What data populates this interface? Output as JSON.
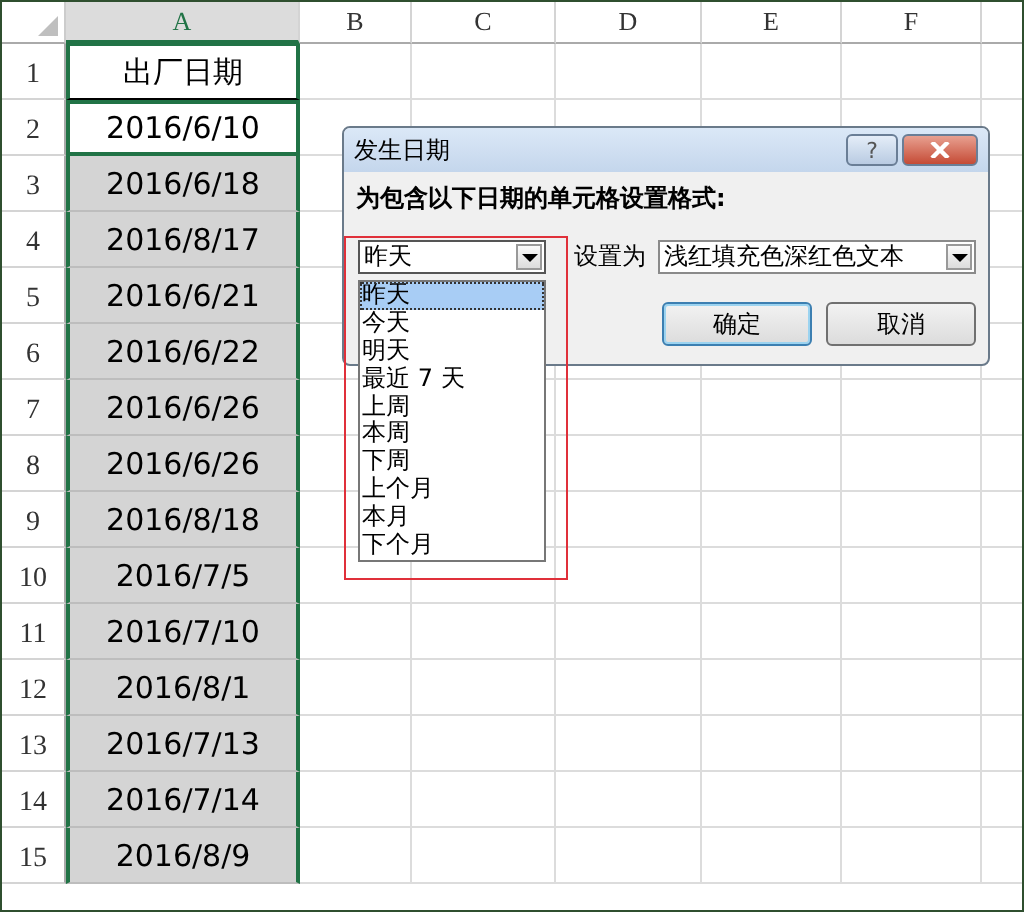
{
  "sheet": {
    "columns": [
      {
        "label": "A",
        "selected": true
      },
      {
        "label": "B",
        "selected": false
      },
      {
        "label": "C",
        "selected": false
      },
      {
        "label": "D",
        "selected": false
      },
      {
        "label": "E",
        "selected": false
      },
      {
        "label": "F",
        "selected": false
      }
    ],
    "rows": [
      {
        "number": "1",
        "value": "出厂日期",
        "kind": "header"
      },
      {
        "number": "2",
        "value": "2016/6/10",
        "kind": "active"
      },
      {
        "number": "3",
        "value": "2016/6/18",
        "kind": "highlighted"
      },
      {
        "number": "4",
        "value": "2016/8/17",
        "kind": "highlighted"
      },
      {
        "number": "5",
        "value": "2016/6/21",
        "kind": "highlighted"
      },
      {
        "number": "6",
        "value": "2016/6/22",
        "kind": "highlighted"
      },
      {
        "number": "7",
        "value": "2016/6/26",
        "kind": "highlighted"
      },
      {
        "number": "8",
        "value": "2016/6/26",
        "kind": "highlighted"
      },
      {
        "number": "9",
        "value": "2016/8/18",
        "kind": "highlighted"
      },
      {
        "number": "10",
        "value": "2016/7/5",
        "kind": "highlighted"
      },
      {
        "number": "11",
        "value": "2016/7/10",
        "kind": "highlighted"
      },
      {
        "number": "12",
        "value": "2016/8/1",
        "kind": "highlighted"
      },
      {
        "number": "13",
        "value": "2016/7/13",
        "kind": "highlighted"
      },
      {
        "number": "14",
        "value": "2016/7/14",
        "kind": "highlighted"
      },
      {
        "number": "15",
        "value": "2016/8/9",
        "kind": "highlighted"
      }
    ]
  },
  "dialog": {
    "title": "发生日期",
    "help": "?",
    "heading": "为包含以下日期的单元格设置格式:",
    "date_combo": {
      "value": "昨天",
      "expanded": true
    },
    "date_options": [
      {
        "label": "昨天",
        "selected": true
      },
      {
        "label": "今天",
        "selected": false
      },
      {
        "label": "明天",
        "selected": false
      },
      {
        "label": "最近 7 天",
        "selected": false
      },
      {
        "label": "上周",
        "selected": false
      },
      {
        "label": "本周",
        "selected": false
      },
      {
        "label": "下周",
        "selected": false
      },
      {
        "label": "上个月",
        "selected": false
      },
      {
        "label": "本月",
        "selected": false
      },
      {
        "label": "下个月",
        "selected": false
      }
    ],
    "format_label": "设置为",
    "format_combo": {
      "value": "浅红填充色深红色文本"
    },
    "buttons": [
      {
        "label": "确定",
        "default": true
      },
      {
        "label": "取消",
        "default": false
      }
    ]
  }
}
